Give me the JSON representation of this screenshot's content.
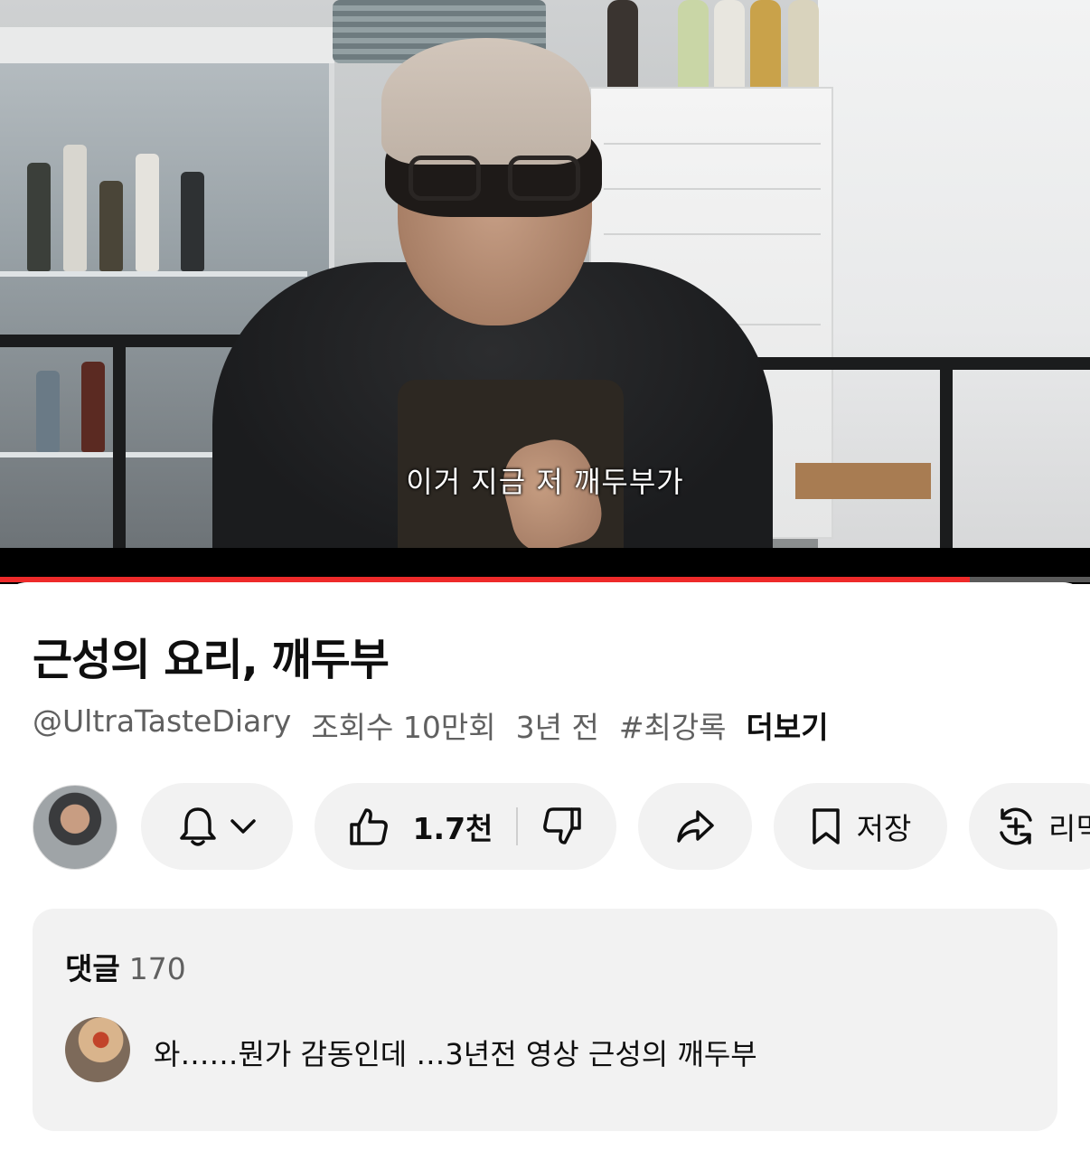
{
  "video": {
    "subtitle": "이거 지금 저 깨두부가",
    "progress_percent": 89
  },
  "info": {
    "title": "근성의 요리, 깨두부",
    "channel": "@UltraTasteDiary",
    "views": "조회수 10만회",
    "age": "3년 전",
    "hashtag": "#최강록",
    "more_label": "더보기"
  },
  "actions": {
    "subscribe_icon": "bell-icon",
    "like_icon": "thumbs-up-icon",
    "like_count": "1.7천",
    "dislike_icon": "thumbs-down-icon",
    "share_icon": "share-icon",
    "save_icon": "bookmark-icon",
    "save_label": "저장",
    "remix_icon": "remix-icon",
    "remix_label": "리믹"
  },
  "comments": {
    "header": "댓글",
    "count": "170",
    "top_comment": "와……뭔가 감동인데 …3년전 영상 근성의 깨두부"
  },
  "colors": {
    "progress": "#ee2a2a",
    "pill_bg": "#f2f2f2",
    "meta_text": "#606060"
  }
}
